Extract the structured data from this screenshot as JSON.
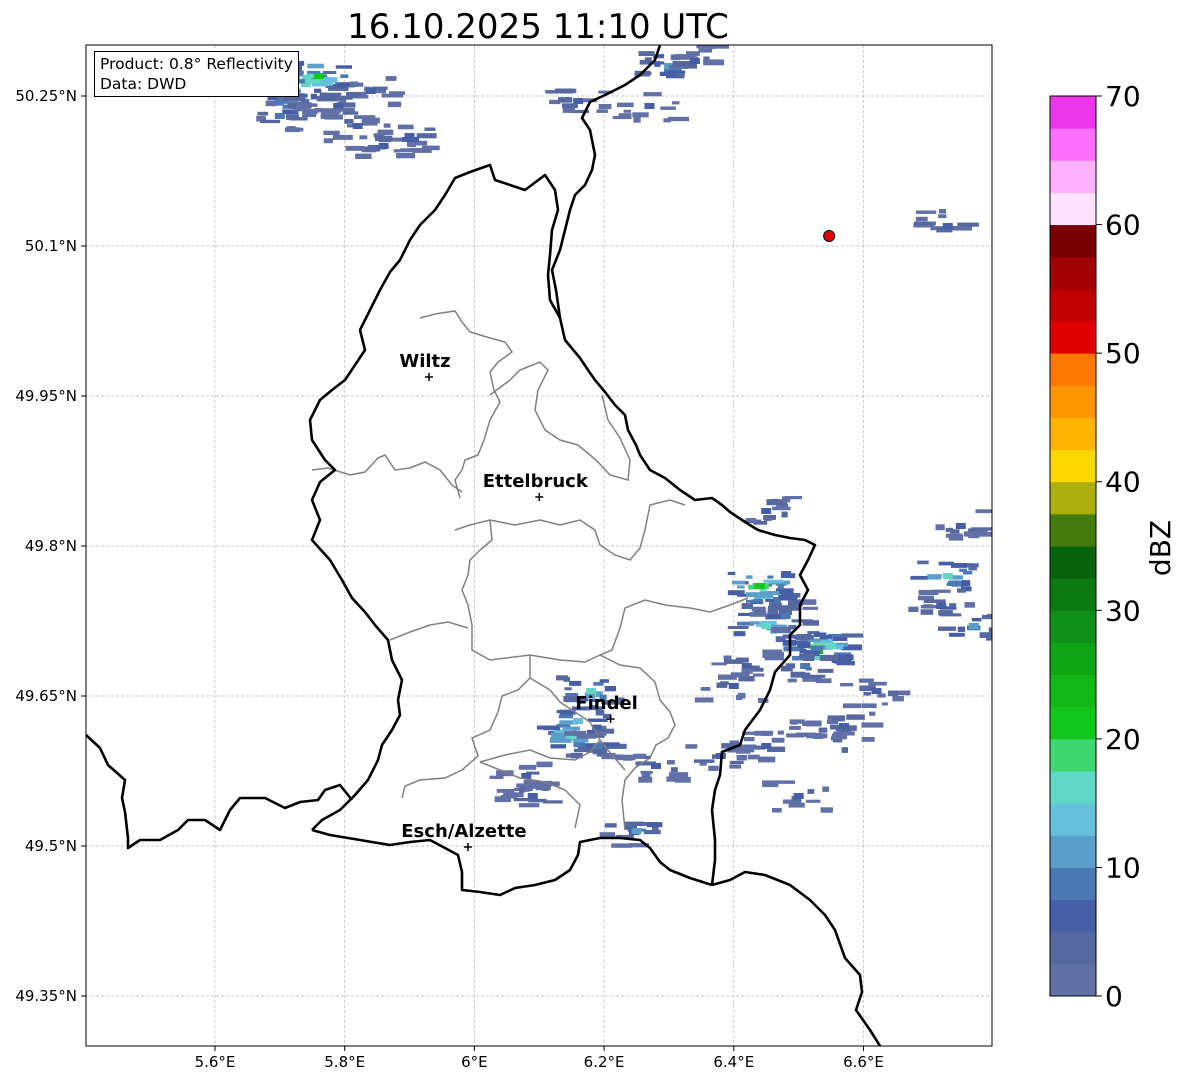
{
  "title": "16.10.2025 11:10 UTC",
  "info": {
    "product": "Product: 0.8° Reflectivity",
    "data": "Data: DWD"
  },
  "axes": {
    "lon_ticks": [
      {
        "value": 5.6,
        "label": "5.6°E"
      },
      {
        "value": 5.8,
        "label": "5.8°E"
      },
      {
        "value": 6.0,
        "label": "6°E"
      },
      {
        "value": 6.2,
        "label": "6.2°E"
      },
      {
        "value": 6.4,
        "label": "6.4°E"
      },
      {
        "value": 6.6,
        "label": "6.6°E"
      }
    ],
    "lat_ticks": [
      {
        "value": 50.25,
        "label": "50.25°N"
      },
      {
        "value": 50.1,
        "label": "50.1°N"
      },
      {
        "value": 49.95,
        "label": "49.95°N"
      },
      {
        "value": 49.8,
        "label": "49.8°N"
      },
      {
        "value": 49.65,
        "label": "49.65°N"
      },
      {
        "value": 49.5,
        "label": "49.5°N"
      },
      {
        "value": 49.35,
        "label": "49.35°N"
      }
    ]
  },
  "cities": [
    {
      "name": "Wiltz",
      "lon": 5.93,
      "lat": 49.969
    },
    {
      "name": "Ettelbruck",
      "lon": 6.1,
      "lat": 49.849
    },
    {
      "name": "Findel",
      "lon": 6.21,
      "lat": 49.627
    },
    {
      "name": "Esch/Alzette",
      "lon": 5.99,
      "lat": 49.499
    }
  ],
  "radar_site": {
    "lon": 6.547,
    "lat": 50.11,
    "color": "#e00000"
  },
  "colorbar": {
    "label": "dBZ",
    "ticks": [
      "0",
      "10",
      "20",
      "30",
      "40",
      "50",
      "60",
      "70"
    ],
    "colors": [
      "#6171a8",
      "#55689f",
      "#465ea5",
      "#4a79b3",
      "#5a9ec9",
      "#66c0dd",
      "#60d8c5",
      "#3fd870",
      "#12c81c",
      "#12b818",
      "#0ea414",
      "#10901a",
      "#0b7a10",
      "#08640c",
      "#457a0c",
      "#adb00c",
      "#fcd800",
      "#fcb400",
      "#fc9600",
      "#fc7800",
      "#e00000",
      "#c00000",
      "#a00000",
      "#780000",
      "#ffe0ff",
      "#ffb0ff",
      "#ff70ff",
      "#ec36ec"
    ]
  },
  "chart_data": {
    "type": "heatmap",
    "title": "16.10.2025 11:10 UTC",
    "xlabel": "",
    "ylabel": "",
    "xlim": [
      5.4,
      6.8
    ],
    "ylim": [
      49.3,
      50.3
    ],
    "value_label": "dBZ",
    "value_range": [
      0,
      70
    ],
    "radar_cells": [
      {
        "lon": 5.72,
        "lat": 50.245,
        "dbz": 14
      },
      {
        "lon": 5.74,
        "lat": 50.262,
        "dbz": 16
      },
      {
        "lon": 5.76,
        "lat": 50.27,
        "dbz": 22
      },
      {
        "lon": 5.7,
        "lat": 50.23,
        "dbz": 8
      },
      {
        "lon": 5.79,
        "lat": 50.24,
        "dbz": 6
      },
      {
        "lon": 5.82,
        "lat": 50.22,
        "dbz": 5
      },
      {
        "lon": 5.86,
        "lat": 50.2,
        "dbz": 6
      },
      {
        "lon": 5.9,
        "lat": 50.21,
        "dbz": 7
      },
      {
        "lon": 5.84,
        "lat": 50.255,
        "dbz": 5
      },
      {
        "lon": 6.45,
        "lat": 49.75,
        "dbz": 15
      },
      {
        "lon": 6.45,
        "lat": 49.72,
        "dbz": 17
      },
      {
        "lon": 6.44,
        "lat": 49.76,
        "dbz": 22
      },
      {
        "lon": 6.48,
        "lat": 49.73,
        "dbz": 8
      },
      {
        "lon": 6.53,
        "lat": 49.695,
        "dbz": 24
      },
      {
        "lon": 6.55,
        "lat": 49.7,
        "dbz": 16
      },
      {
        "lon": 6.51,
        "lat": 49.68,
        "dbz": 8
      },
      {
        "lon": 6.42,
        "lat": 49.68,
        "dbz": 7
      },
      {
        "lon": 6.4,
        "lat": 49.66,
        "dbz": 6
      },
      {
        "lon": 6.18,
        "lat": 49.655,
        "dbz": 16
      },
      {
        "lon": 6.16,
        "lat": 49.625,
        "dbz": 14
      },
      {
        "lon": 6.15,
        "lat": 49.61,
        "dbz": 17
      },
      {
        "lon": 6.19,
        "lat": 49.6,
        "dbz": 8
      },
      {
        "lon": 6.08,
        "lat": 49.57,
        "dbz": 7
      },
      {
        "lon": 6.09,
        "lat": 49.55,
        "dbz": 6
      },
      {
        "lon": 6.25,
        "lat": 49.515,
        "dbz": 10
      },
      {
        "lon": 6.38,
        "lat": 49.59,
        "dbz": 7
      },
      {
        "lon": 6.45,
        "lat": 49.6,
        "dbz": 6
      },
      {
        "lon": 6.53,
        "lat": 49.61,
        "dbz": 8
      },
      {
        "lon": 6.57,
        "lat": 49.62,
        "dbz": 7
      },
      {
        "lon": 6.73,
        "lat": 49.77,
        "dbz": 16
      },
      {
        "lon": 6.72,
        "lat": 49.74,
        "dbz": 7
      },
      {
        "lon": 6.77,
        "lat": 49.72,
        "dbz": 12
      },
      {
        "lon": 6.75,
        "lat": 49.82,
        "dbz": 6
      },
      {
        "lon": 6.62,
        "lat": 49.655,
        "dbz": 6
      },
      {
        "lon": 6.73,
        "lat": 50.12,
        "dbz": 6
      },
      {
        "lon": 6.3,
        "lat": 50.28,
        "dbz": 12
      },
      {
        "lon": 6.34,
        "lat": 50.285,
        "dbz": 6
      },
      {
        "lon": 6.27,
        "lat": 50.24,
        "dbz": 5
      },
      {
        "lon": 6.16,
        "lat": 50.245,
        "dbz": 6
      },
      {
        "lon": 6.45,
        "lat": 49.835,
        "dbz": 7
      },
      {
        "lon": 6.5,
        "lat": 49.55,
        "dbz": 6
      },
      {
        "lon": 6.28,
        "lat": 49.58,
        "dbz": 6
      }
    ]
  }
}
